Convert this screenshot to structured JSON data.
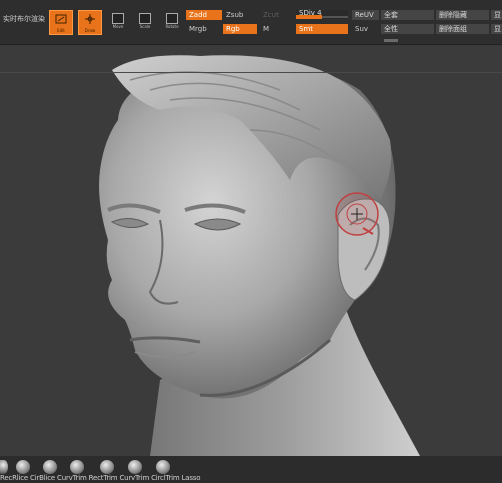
{
  "menu": {
    "boolean_render_label": "实时布尔渲染"
  },
  "tools": {
    "edit_label": "Edit",
    "draw_label": "Draw",
    "move_label": "Move",
    "scale_label": "Scale",
    "rotate_label": "Rotate"
  },
  "brush": {
    "zadd": "Zadd",
    "zsub": "Zsub",
    "zcut": "Zcut",
    "mrgb": "Mrgb",
    "rgb": "Rgb",
    "m": "M"
  },
  "sdiv": {
    "label": "SDiv 4",
    "level_fraction": 0.5
  },
  "smt": "Smt",
  "reuv": "ReUV",
  "suv": "Suv",
  "visibility": {
    "all": "全套",
    "delete_hidden": "删除隐藏",
    "invert": "全性",
    "delete_inner": "删除面组",
    "other1": "显示",
    "other2": "显示"
  },
  "shelf": {
    "labels": "RecRlice CirBlice CurvTrim RectTrim CurvTrim CirclTrim Lasso"
  },
  "colors": {
    "accent": "#e8731a",
    "panel": "#2e2e2e",
    "canvas": "#3b3b3b"
  }
}
